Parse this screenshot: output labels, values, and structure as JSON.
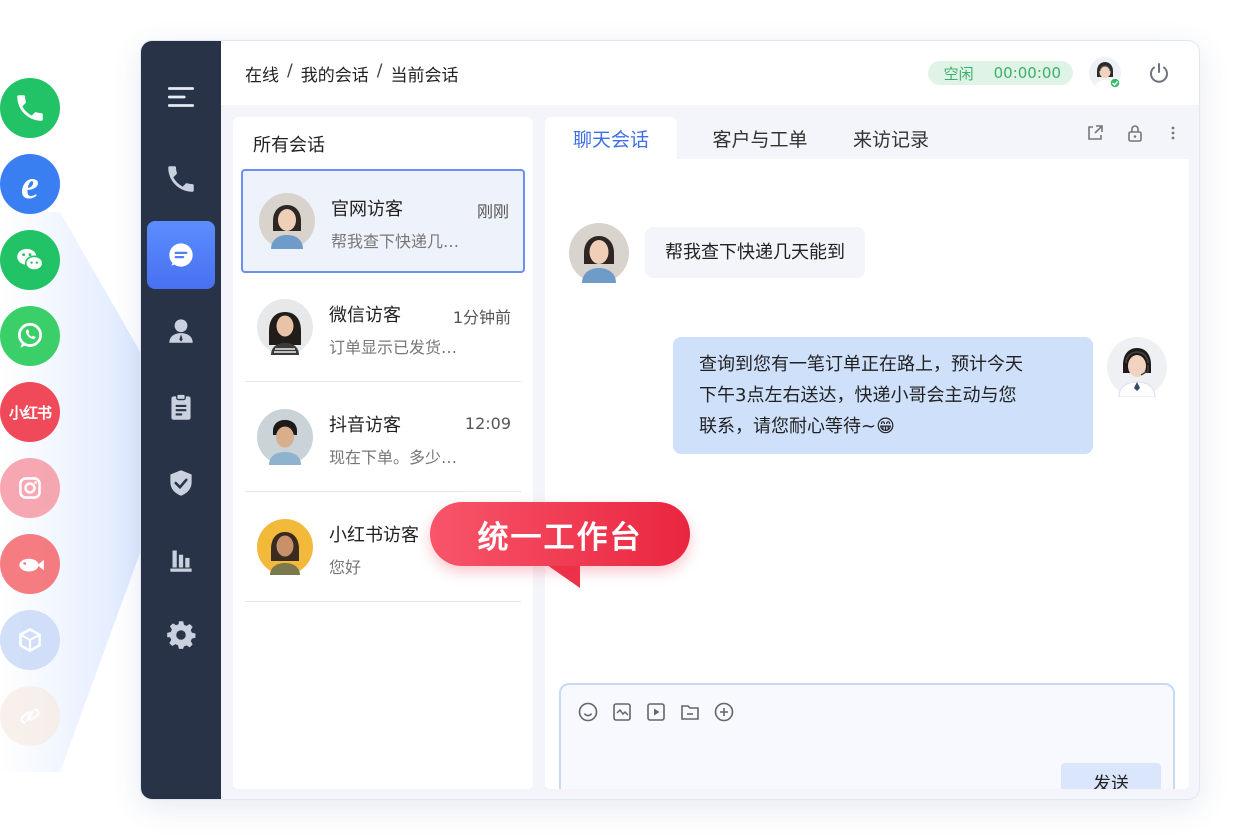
{
  "channels": [
    {
      "name": "phone",
      "icon": "phone-icon",
      "color": "#2bc26b"
    },
    {
      "name": "ie",
      "icon": "ie-browser-icon",
      "color": "#3f7ff0"
    },
    {
      "name": "wechat",
      "icon": "wechat-icon",
      "color": "#2bc26b"
    },
    {
      "name": "whatsapp",
      "icon": "whatsapp-icon",
      "color": "#3dcf6b"
    },
    {
      "name": "xiaohongshu",
      "icon": "xiaohongshu-icon",
      "label": "小红书",
      "color": "#f04b5b"
    },
    {
      "name": "instagram",
      "icon": "instagram-icon",
      "color": "#f36b7a"
    },
    {
      "name": "douyu",
      "icon": "fish-icon",
      "color": "#f46a6a"
    },
    {
      "name": "mini-program",
      "icon": "cube-icon",
      "color": "#bcd0f7"
    },
    {
      "name": "mini-app",
      "icon": "link-icon",
      "color": "#f6e6dc"
    }
  ],
  "sidebar": {
    "items": [
      {
        "name": "menu",
        "icon": "menu-icon"
      },
      {
        "name": "phone",
        "icon": "phone-icon"
      },
      {
        "name": "chat",
        "icon": "chat-icon",
        "active": true
      },
      {
        "name": "contacts",
        "icon": "user-icon"
      },
      {
        "name": "tickets",
        "icon": "clipboard-icon"
      },
      {
        "name": "security",
        "icon": "shield-icon"
      },
      {
        "name": "reports",
        "icon": "bar-chart-icon"
      },
      {
        "name": "settings",
        "icon": "gear-icon"
      }
    ]
  },
  "header": {
    "breadcrumb": [
      "在线",
      "我的会话",
      "当前会话"
    ],
    "breadcrumb_sep": "/",
    "status_label": "空闲",
    "status_timer": "00:00:00"
  },
  "conversations": {
    "title": "所有会话",
    "items": [
      {
        "name": "官网访客",
        "time": "刚刚",
        "preview": "帮我查下快递几…",
        "selected": true
      },
      {
        "name": "微信访客",
        "time": "1分钟前",
        "preview": "订单显示已发货…"
      },
      {
        "name": "抖音访客",
        "time": "12:09",
        "preview": "现在下单。多少…"
      },
      {
        "name": "小红书访客",
        "time": "",
        "preview": "您好"
      }
    ]
  },
  "chat": {
    "tabs": [
      {
        "label": "聊天会话",
        "active": true
      },
      {
        "label": "客户与工单"
      },
      {
        "label": "来访记录"
      }
    ],
    "tools": [
      "share-icon",
      "lock-icon",
      "more-icon"
    ],
    "messages": [
      {
        "from": "visitor",
        "text": "帮我查下快递几天能到"
      },
      {
        "from": "agent",
        "lines": [
          "查询到您有一笔订单正在路上，预计今天",
          "下午3点左右送达，快递小哥会主动与您",
          "联系，请您耐心等待~😁"
        ]
      }
    ],
    "composer_tools": [
      "emoji-icon",
      "screenshot-icon",
      "video-icon",
      "folder-icon",
      "plus-circle-icon"
    ],
    "send_label": "发送"
  },
  "callout": "统一工作台"
}
